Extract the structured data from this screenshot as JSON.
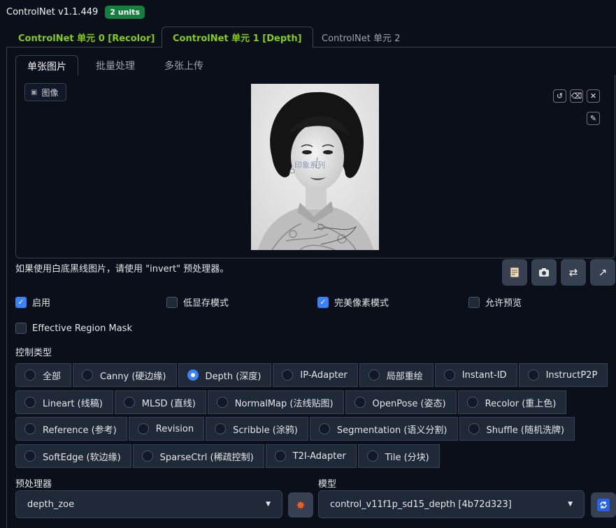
{
  "header": {
    "title": "ControlNet v1.1.449",
    "badge": "2 units"
  },
  "unit_tabs": [
    "ControlNet 单元 0 [Recolor]",
    "ControlNet 单元 1 [Depth]",
    "ControlNet 单元 2"
  ],
  "image_tabs": [
    "单张图片",
    "批量处理",
    "多张上传"
  ],
  "image_panel": {
    "label": "图像",
    "label_icon": "image-icon",
    "watermark": "印象系列"
  },
  "hint": "如果使用白底黑线图片，请使用 \"invert\" 预处理器。",
  "checkboxes": {
    "enable": "启用",
    "low_vram": "低显存模式",
    "pixel_perfect": "完美像素模式",
    "allow_preview": "允许预览",
    "effective_region_mask": "Effective Region Mask"
  },
  "control_type": {
    "label": "控制类型",
    "rows": [
      [
        "全部",
        "Canny (硬边缘)",
        "Depth (深度)",
        "IP-Adapter",
        "局部重绘",
        "Instant-ID",
        "InstructP2P"
      ],
      [
        "Lineart (线稿)",
        "MLSD (直线)",
        "NormalMap (法线贴图)",
        "OpenPose (姿态)",
        "Recolor (重上色)"
      ],
      [
        "Reference (参考)",
        "Revision",
        "Scribble (涂鸦)",
        "Segmentation (语义分割)",
        "Shuffle (随机洗牌)"
      ],
      [
        "SoftEdge (软边缘)",
        "SparseCtrl (稀疏控制)",
        "T2I-Adapter",
        "Tile (分块)"
      ]
    ],
    "selected": "Depth (深度)"
  },
  "preprocessor": {
    "label": "预处理器",
    "value": "depth_zoe"
  },
  "model": {
    "label": "模型",
    "value": "control_v11f1p_sd15_depth [4b72d323]"
  },
  "colors": {
    "accent": "#3b82f6",
    "tab_green": "#84cc16",
    "badge": "#15803d",
    "bg": "#0b0f19"
  }
}
